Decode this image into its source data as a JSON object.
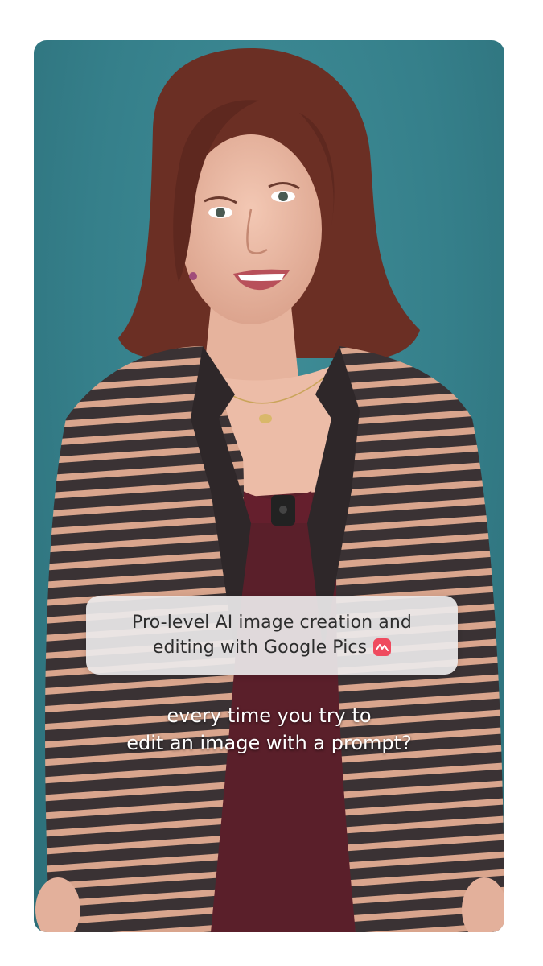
{
  "caption": {
    "line1": "Pro-level AI image creation and",
    "line2": "editing with Google Pics",
    "icon": "google-pics-icon",
    "icon_color": "#ef4b5f"
  },
  "subtitle": {
    "line1": "every time you try to",
    "line2": "edit an image with a prompt?"
  },
  "colors": {
    "background": "#357f8a",
    "subtitle_text": "#ffffff"
  }
}
